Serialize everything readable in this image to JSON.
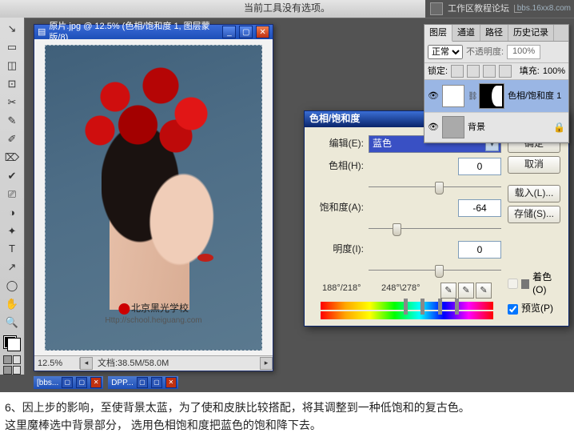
{
  "options_bar": {
    "text": "当前工具没有选项。"
  },
  "workspace_label": "工作区教程论坛",
  "br_watermark": "bbs.16xx8.com",
  "toolbox": {
    "tools": [
      "↘",
      "▭",
      "◫",
      "⊡",
      "✂",
      "✎",
      "✐",
      "⌦",
      "✔",
      "⎚",
      "◑",
      "✦",
      "T",
      "↗",
      "◯",
      "✋",
      "🔍"
    ]
  },
  "document": {
    "title": "原片.jpg @ 12.5% (色相/饱和度 1, 图层蒙版/8)",
    "zoom": "12.5%",
    "status_info": "文档:38.5M/58.0M",
    "watermark_line1": "北京黑光学校",
    "watermark_line2": "Http://school.heiguang.com"
  },
  "dialog": {
    "title": "色相/饱和度",
    "edit_label": "编辑(E):",
    "edit_value": "蓝色",
    "hue_label": "色相(H):",
    "hue_value": "0",
    "sat_label": "饱和度(A):",
    "sat_value": "-64",
    "light_label": "明度(I):",
    "light_value": "0",
    "range_left": "188°/218°",
    "range_right": "248°\\278°",
    "colorize_label": "着色(O)",
    "preview_label": "预览(P)",
    "buttons": {
      "ok": "确定",
      "cancel": "取消",
      "load": "载入(L)...",
      "save": "存储(S)..."
    }
  },
  "layers_panel": {
    "tabs": [
      "图层",
      "通道",
      "路径",
      "历史记录"
    ],
    "blend_mode": "正常",
    "opacity_label": "不透明度:",
    "opacity_value": "100%",
    "lock_label": "锁定:",
    "fill_label": "填充:",
    "fill_value": "100%",
    "layers": [
      {
        "name": "色相/饱和度 1"
      },
      {
        "name": "背景"
      }
    ]
  },
  "taskbar": {
    "docs": [
      "[bbs...",
      "DPP..."
    ]
  },
  "caption_lines": [
    "6、因上步的影响，至使背景太蓝，为了使和皮肤比较搭配，将其调整到一种低饱和的复古色。",
    "这里魔棒选中背景部分，  选用色相饱和度把蓝色的饱和降下去。"
  ]
}
